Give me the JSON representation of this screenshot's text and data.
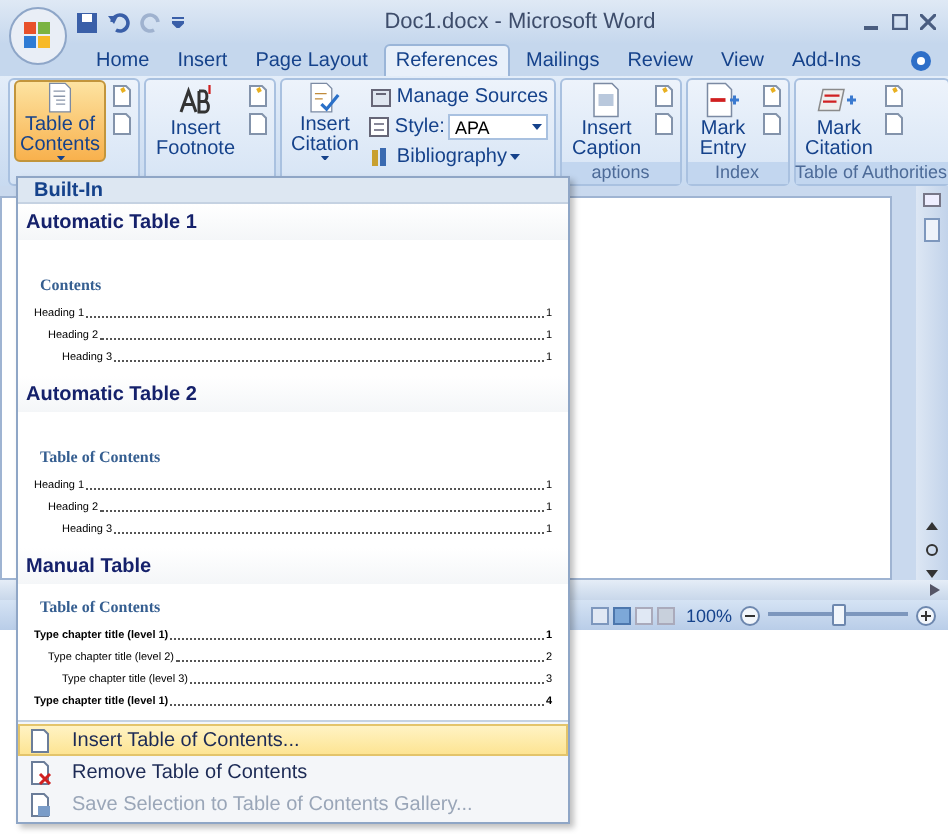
{
  "window": {
    "title": "Doc1.docx - Microsoft Word"
  },
  "tabs": [
    {
      "label": "Home",
      "selected": false
    },
    {
      "label": "Insert",
      "selected": false
    },
    {
      "label": "Page Layout",
      "selected": false
    },
    {
      "label": "References",
      "selected": true
    },
    {
      "label": "Mailings",
      "selected": false
    },
    {
      "label": "Review",
      "selected": false
    },
    {
      "label": "View",
      "selected": false
    },
    {
      "label": "Add-Ins",
      "selected": false
    }
  ],
  "ribbon": {
    "groups": [
      {
        "large": {
          "lines": [
            "Table of",
            "Contents"
          ],
          "dropdown": true,
          "pressed": true,
          "kind": "toc"
        },
        "side": {
          "kind": "icons"
        }
      },
      {
        "large": {
          "lines": [
            "Insert",
            "Footnote"
          ],
          "dropdown": false,
          "pressed": false,
          "kind": "footnote"
        },
        "side": {
          "kind": "icons"
        }
      },
      {
        "large": {
          "lines": [
            "Insert",
            "Citation"
          ],
          "dropdown": true,
          "pressed": false,
          "kind": "citation"
        },
        "side": {
          "kind": "citations",
          "manage": "Manage Sources",
          "style_label": "Style:",
          "style_value": "APA",
          "bibliography": "Bibliography"
        }
      },
      {
        "large": {
          "lines": [
            "Insert",
            "Caption"
          ],
          "dropdown": false,
          "pressed": false,
          "kind": "caption"
        },
        "side": {
          "kind": "icons"
        },
        "label": "aptions"
      },
      {
        "large": {
          "lines": [
            "Mark",
            "Entry"
          ],
          "dropdown": false,
          "pressed": false,
          "kind": "entry"
        },
        "side": {
          "kind": "icons"
        },
        "label": "Index"
      },
      {
        "large": {
          "lines": [
            "Mark",
            "Citation"
          ],
          "dropdown": false,
          "pressed": false,
          "kind": "mark_citation"
        },
        "side": {
          "kind": "icons"
        },
        "label": "Table of Authorities"
      }
    ]
  },
  "menu": {
    "header": "Built-In",
    "sections": [
      {
        "title": "Automatic Table 1",
        "kind": "automatic",
        "heading": "Contents",
        "entries": [
          {
            "text": "Heading 1",
            "page": "1",
            "children": [
              {
                "text": "Heading 2",
                "page": "1",
                "children": [
                  {
                    "text": "Heading 3",
                    "page": "1"
                  }
                ]
              }
            ]
          }
        ]
      },
      {
        "title": "Automatic Table 2",
        "kind": "automatic",
        "heading": "Table of Contents",
        "entries": [
          {
            "text": "Heading 1",
            "page": "1",
            "children": [
              {
                "text": "Heading 2",
                "page": "1",
                "children": [
                  {
                    "text": "Heading 3",
                    "page": "1"
                  }
                ]
              }
            ]
          }
        ]
      },
      {
        "title": "Manual Table",
        "kind": "manual",
        "heading": "Table of Contents",
        "entries": [
          {
            "text": "Type chapter title (level 1)",
            "page": "1",
            "children": [
              {
                "text": "Type chapter title (level 2)",
                "page": "2",
                "children": [
                  {
                    "text": "Type chapter title (level 3)",
                    "page": "3"
                  }
                ]
              }
            ]
          },
          {
            "text": "Type chapter title (level 1)",
            "page": "4"
          }
        ]
      }
    ],
    "commands": [
      {
        "label": "Insert Table of Contents...",
        "kind": "insert",
        "selected": true,
        "disabled": false
      },
      {
        "label": "Remove Table of Contents",
        "kind": "remove",
        "selected": false,
        "disabled": false
      },
      {
        "label": "Save Selection to Table of Contents Gallery...",
        "kind": "save",
        "selected": false,
        "disabled": true
      }
    ]
  },
  "status_bar": {
    "zoom": "100%",
    "zoom_slider": {
      "level": 0.5
    }
  }
}
